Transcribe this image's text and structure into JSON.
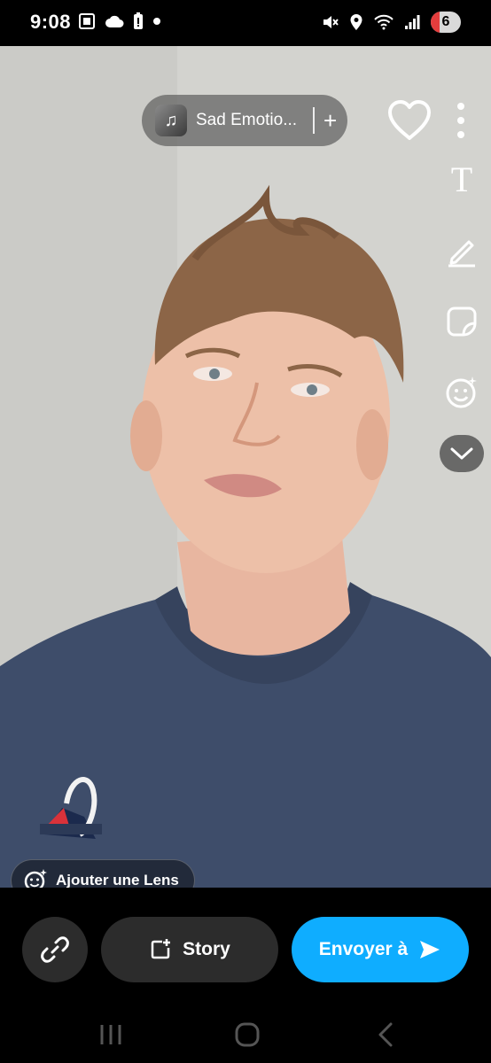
{
  "status_bar": {
    "time": "9:08",
    "battery_level": "6",
    "left_icons": [
      "screenshot-icon",
      "cloud-icon",
      "battery-alert-icon",
      "dot-icon"
    ],
    "right_icons": [
      "mute-icon",
      "location-icon",
      "wifi-icon",
      "signal-icon"
    ]
  },
  "music": {
    "title": "Sad Emotio...",
    "add_label": "+"
  },
  "toolbar": {
    "text_tool": "T",
    "tools": [
      "text-tool-icon",
      "pencil-icon",
      "sticker-icon",
      "lens-add-icon",
      "chevron-down-icon"
    ]
  },
  "lens": {
    "label": "Ajouter une Lens"
  },
  "actions": {
    "story_label": "Story",
    "send_label": "Envoyer à"
  },
  "colors": {
    "send_button": "#0fadff",
    "dark_button": "#2c2c2c",
    "battery_low": "#e43d3d"
  }
}
